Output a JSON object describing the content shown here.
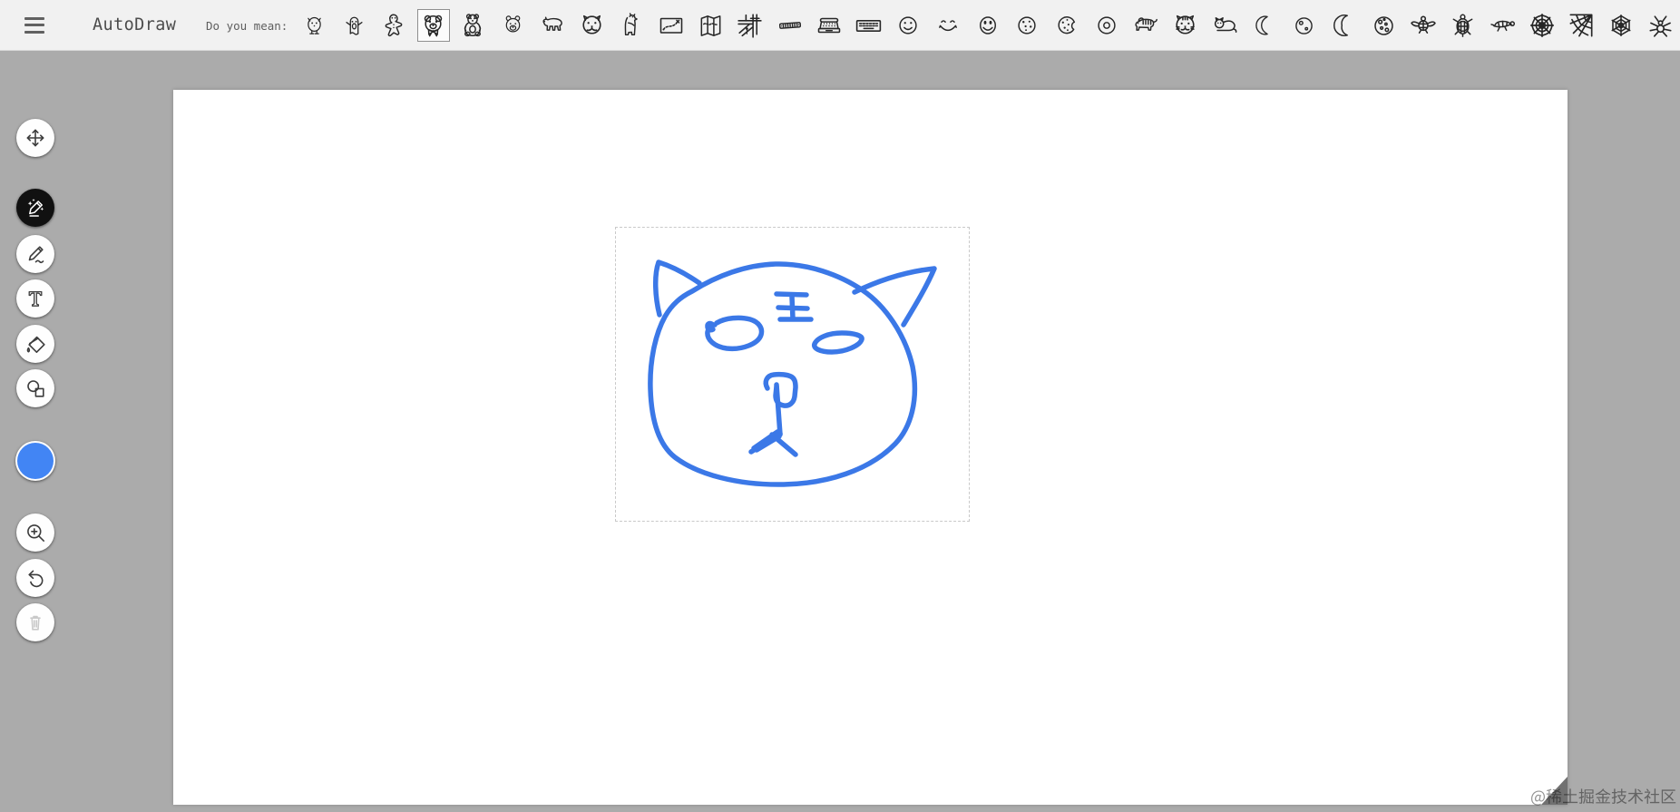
{
  "header": {
    "app_title": "AutoDraw",
    "prompt_label": "Do you mean:",
    "selected_suggestion": "teddy-bear-face",
    "selected_suggestion_index": 3,
    "suggestions": [
      "monster-cub",
      "ghost-monster",
      "gingerbread-man",
      "teddy-bear-face",
      "teddy-bear-sitting",
      "polar-bear-face",
      "bear-walking",
      "cougar-face",
      "bear-standing",
      "treasure-map",
      "folded-map",
      "street-map",
      "harmonica",
      "typewriter",
      "keyboard",
      "smiley-face",
      "smiling-eyes",
      "laughing-face",
      "cookie",
      "bitten-cookie",
      "donut",
      "tiger-walking",
      "tiger-face",
      "cat-lying",
      "crescent-thin",
      "moon-with-craters",
      "crescent-moon",
      "full-moon",
      "sea-turtle-diving",
      "sea-turtle-top",
      "turtle-swimming",
      "spiderweb-round",
      "spiderweb-corner",
      "spiderweb-hex",
      "spider"
    ]
  },
  "toolbar": {
    "tools": [
      {
        "id": "select",
        "icon": "move-icon",
        "state": "normal"
      },
      {
        "id": "autodraw",
        "icon": "magic-pencil-icon",
        "state": "active"
      },
      {
        "id": "draw",
        "icon": "pencil-icon",
        "state": "normal"
      },
      {
        "id": "type",
        "icon": "text-icon",
        "state": "normal"
      },
      {
        "id": "fill",
        "icon": "paint-bucket-icon",
        "state": "normal"
      },
      {
        "id": "shape",
        "icon": "shapes-icon",
        "state": "normal"
      },
      {
        "id": "color",
        "icon": "color-swatch",
        "value": "#4285f4",
        "state": "normal"
      },
      {
        "id": "zoom",
        "icon": "zoom-in-icon",
        "state": "normal"
      },
      {
        "id": "undo",
        "icon": "undo-icon",
        "state": "normal"
      },
      {
        "id": "delete",
        "icon": "trash-icon",
        "state": "disabled"
      }
    ]
  },
  "canvas": {
    "drawing_description": "hand-drawn cat face in blue ink with selection box",
    "stroke_color": "#3b78e7"
  },
  "watermark": {
    "text": "@稀土掘金技术社区"
  },
  "colors": {
    "stage_background": "#ababab",
    "topbar_background": "#f1f1f1",
    "accent_blue": "#4285f4",
    "canvas": "#ffffff"
  }
}
